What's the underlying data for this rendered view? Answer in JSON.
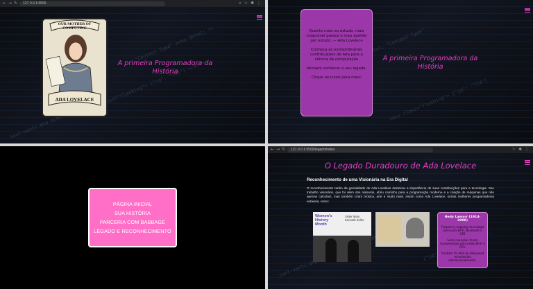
{
  "q1": {
    "url": "127.0.0.1:5500",
    "tagline": "A primeira Programadora da História",
    "poster": {
      "top_text": "OUR MOTHER OF COMPUTING",
      "bottom_text": "ADA LOVELACE"
    }
  },
  "q2": {
    "card": {
      "quote": "Quanto mais eu estudo, mais insaciável parece o meu apetite por estudo. — Ada Lovelace",
      "intro": "Conheça as extraordinárias contribuições de Ada para a ciência da computação",
      "invite": "Venham conhecer o seu legado.",
      "cta": "Clique no ícone para mais!"
    },
    "tagline": "A primeira Programadora da História"
  },
  "q3": {
    "menu": [
      "PÁGINA INICIAL",
      "SUA HISTÓRIA",
      "PARCERIA COM BABBAGE",
      "LEGADO E RECONHECIMENTO"
    ]
  },
  "q4": {
    "url": "127.0.0.1:5500/legado/index",
    "title": "O Legado Duradouro de Ada Lovelace",
    "subtitle": "Reconhecimento de uma Visionária na Era Digital",
    "paragraph": "O reconhecimento tardio da genialidade de Ada Lovelace destacou a importância de suas contribuições para a tecnologia. Seu trabalho visionário, que foi além dos números, abriu caminho para a programação moderna e a criação de máquinas que não apenas calculam, mas também criam música, arte e muito mais. Assim como Ada Lovelace, outras mulheres programadoras notáveis, como:",
    "photo1": {
      "badge": "Women's History Month",
      "names": "Sister Mary Kenneth Keller"
    },
    "card": {
      "caption": "Hedy Lamarr (1914-2000)",
      "line1": "Frequency hopping: tecnologia base para Wi-Fi, Bluetooth e GPS",
      "line2": "Suas invenções foram fundamentais para redes Wi-Fi e GPS.",
      "line3": "Também foi atriz de Hollywood reconhecida internacionalmente."
    }
  }
}
